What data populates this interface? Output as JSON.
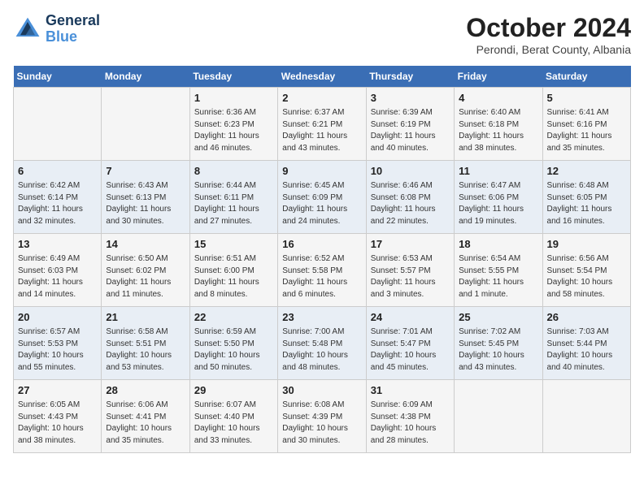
{
  "header": {
    "logo_line1": "General",
    "logo_line2": "Blue",
    "month": "October 2024",
    "location": "Perondi, Berat County, Albania"
  },
  "weekdays": [
    "Sunday",
    "Monday",
    "Tuesday",
    "Wednesday",
    "Thursday",
    "Friday",
    "Saturday"
  ],
  "weeks": [
    [
      null,
      null,
      {
        "day": 1,
        "sunrise": "6:36 AM",
        "sunset": "6:23 PM",
        "daylight": "11 hours and 46 minutes."
      },
      {
        "day": 2,
        "sunrise": "6:37 AM",
        "sunset": "6:21 PM",
        "daylight": "11 hours and 43 minutes."
      },
      {
        "day": 3,
        "sunrise": "6:39 AM",
        "sunset": "6:19 PM",
        "daylight": "11 hours and 40 minutes."
      },
      {
        "day": 4,
        "sunrise": "6:40 AM",
        "sunset": "6:18 PM",
        "daylight": "11 hours and 38 minutes."
      },
      {
        "day": 5,
        "sunrise": "6:41 AM",
        "sunset": "6:16 PM",
        "daylight": "11 hours and 35 minutes."
      }
    ],
    [
      {
        "day": 6,
        "sunrise": "6:42 AM",
        "sunset": "6:14 PM",
        "daylight": "11 hours and 32 minutes."
      },
      {
        "day": 7,
        "sunrise": "6:43 AM",
        "sunset": "6:13 PM",
        "daylight": "11 hours and 30 minutes."
      },
      {
        "day": 8,
        "sunrise": "6:44 AM",
        "sunset": "6:11 PM",
        "daylight": "11 hours and 27 minutes."
      },
      {
        "day": 9,
        "sunrise": "6:45 AM",
        "sunset": "6:09 PM",
        "daylight": "11 hours and 24 minutes."
      },
      {
        "day": 10,
        "sunrise": "6:46 AM",
        "sunset": "6:08 PM",
        "daylight": "11 hours and 22 minutes."
      },
      {
        "day": 11,
        "sunrise": "6:47 AM",
        "sunset": "6:06 PM",
        "daylight": "11 hours and 19 minutes."
      },
      {
        "day": 12,
        "sunrise": "6:48 AM",
        "sunset": "6:05 PM",
        "daylight": "11 hours and 16 minutes."
      }
    ],
    [
      {
        "day": 13,
        "sunrise": "6:49 AM",
        "sunset": "6:03 PM",
        "daylight": "11 hours and 14 minutes."
      },
      {
        "day": 14,
        "sunrise": "6:50 AM",
        "sunset": "6:02 PM",
        "daylight": "11 hours and 11 minutes."
      },
      {
        "day": 15,
        "sunrise": "6:51 AM",
        "sunset": "6:00 PM",
        "daylight": "11 hours and 8 minutes."
      },
      {
        "day": 16,
        "sunrise": "6:52 AM",
        "sunset": "5:58 PM",
        "daylight": "11 hours and 6 minutes."
      },
      {
        "day": 17,
        "sunrise": "6:53 AM",
        "sunset": "5:57 PM",
        "daylight": "11 hours and 3 minutes."
      },
      {
        "day": 18,
        "sunrise": "6:54 AM",
        "sunset": "5:55 PM",
        "daylight": "11 hours and 1 minute."
      },
      {
        "day": 19,
        "sunrise": "6:56 AM",
        "sunset": "5:54 PM",
        "daylight": "10 hours and 58 minutes."
      }
    ],
    [
      {
        "day": 20,
        "sunrise": "6:57 AM",
        "sunset": "5:53 PM",
        "daylight": "10 hours and 55 minutes."
      },
      {
        "day": 21,
        "sunrise": "6:58 AM",
        "sunset": "5:51 PM",
        "daylight": "10 hours and 53 minutes."
      },
      {
        "day": 22,
        "sunrise": "6:59 AM",
        "sunset": "5:50 PM",
        "daylight": "10 hours and 50 minutes."
      },
      {
        "day": 23,
        "sunrise": "7:00 AM",
        "sunset": "5:48 PM",
        "daylight": "10 hours and 48 minutes."
      },
      {
        "day": 24,
        "sunrise": "7:01 AM",
        "sunset": "5:47 PM",
        "daylight": "10 hours and 45 minutes."
      },
      {
        "day": 25,
        "sunrise": "7:02 AM",
        "sunset": "5:45 PM",
        "daylight": "10 hours and 43 minutes."
      },
      {
        "day": 26,
        "sunrise": "7:03 AM",
        "sunset": "5:44 PM",
        "daylight": "10 hours and 40 minutes."
      }
    ],
    [
      {
        "day": 27,
        "sunrise": "6:05 AM",
        "sunset": "4:43 PM",
        "daylight": "10 hours and 38 minutes."
      },
      {
        "day": 28,
        "sunrise": "6:06 AM",
        "sunset": "4:41 PM",
        "daylight": "10 hours and 35 minutes."
      },
      {
        "day": 29,
        "sunrise": "6:07 AM",
        "sunset": "4:40 PM",
        "daylight": "10 hours and 33 minutes."
      },
      {
        "day": 30,
        "sunrise": "6:08 AM",
        "sunset": "4:39 PM",
        "daylight": "10 hours and 30 minutes."
      },
      {
        "day": 31,
        "sunrise": "6:09 AM",
        "sunset": "4:38 PM",
        "daylight": "10 hours and 28 minutes."
      },
      null,
      null
    ]
  ]
}
